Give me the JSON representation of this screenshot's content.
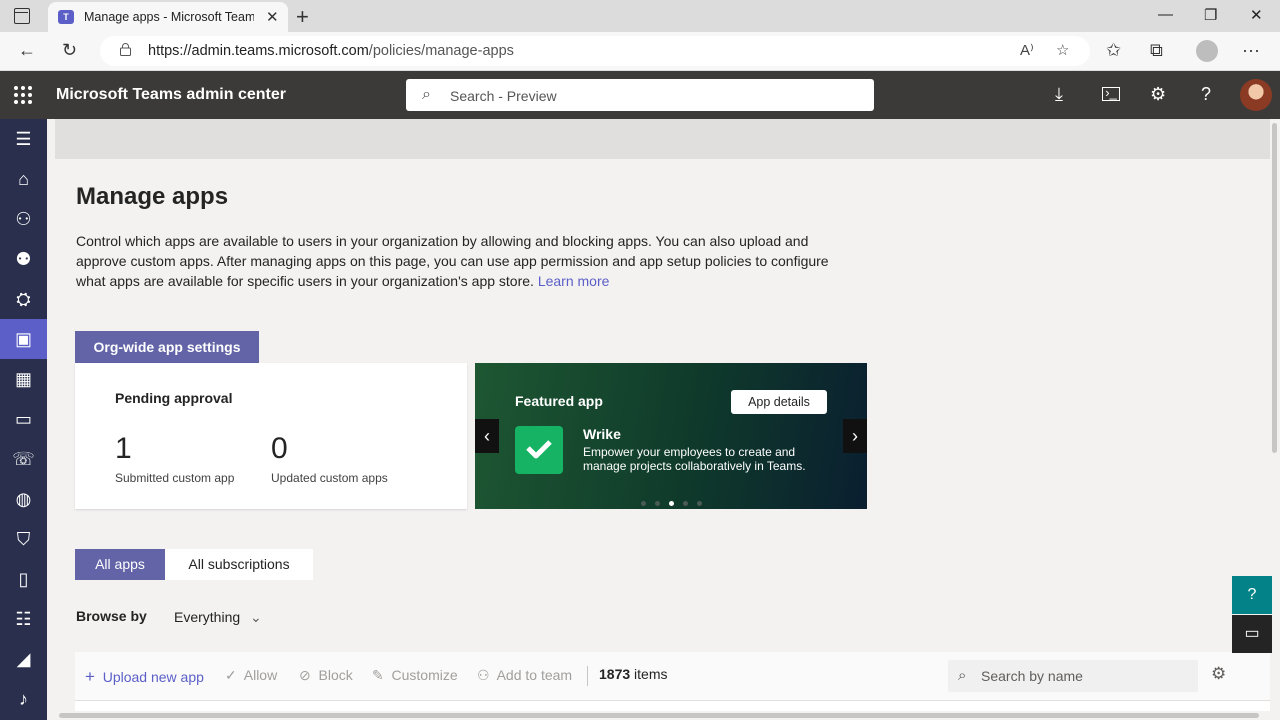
{
  "browser": {
    "tab_title": "Manage apps - Microsoft Teams",
    "tab_favicon": "T",
    "url_domain": "https://admin.teams.microsoft.com",
    "url_path": "/policies/manage-apps"
  },
  "appbar": {
    "title": "Microsoft Teams admin center",
    "search_placeholder": "Search - Preview"
  },
  "page": {
    "title": "Manage apps",
    "description": "Control which apps are available to users in your organization by allowing and blocking apps. You can also upload and approve custom apps. After managing apps on this page, you can use app permission and app setup policies to configure what apps are available for specific users in your organization's app store.",
    "learn_more": "Learn more",
    "org_button": "Org-wide app settings"
  },
  "pending": {
    "title": "Pending approval",
    "submitted_count": "1",
    "submitted_label": "Submitted custom app",
    "updated_count": "0",
    "updated_label": "Updated custom apps"
  },
  "featured": {
    "title": "Featured app",
    "details_button": "App details",
    "app_name": "Wrike",
    "app_desc": "Empower your employees to create and manage projects collaboratively in Teams.",
    "active_dot": 3,
    "dot_count": 5
  },
  "pivots": {
    "all_apps": "All apps",
    "all_subscriptions": "All subscriptions"
  },
  "browse": {
    "label": "Browse by",
    "value": "Everything"
  },
  "commands": {
    "upload": "Upload new app",
    "allow": "Allow",
    "block": "Block",
    "customize": "Customize",
    "add_to_team": "Add to team",
    "count": "1873",
    "count_suffix": " items",
    "search_placeholder": "Search by name"
  },
  "colors": {
    "accent": "#6264a7",
    "rail": "#292f4c",
    "appbar": "#3b3a39",
    "wrike": "#16b364"
  }
}
